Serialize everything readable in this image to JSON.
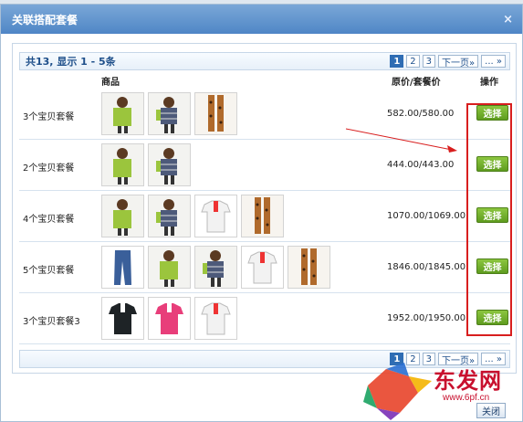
{
  "dialog": {
    "title": "关联搭配套餐",
    "close_glyph": "×"
  },
  "pager": {
    "summary": "共13, 显示 1 - 5条",
    "pages": [
      "1",
      "2",
      "3"
    ],
    "next_label": "下一页»",
    "more_label": "... »"
  },
  "table": {
    "headers": {
      "product": "商品",
      "price": "原价/套餐价",
      "action": "操作"
    },
    "rows": [
      {
        "name": "3个宝贝套餐",
        "price": "582.00/580.00",
        "action": "选择",
        "items": [
          "green-jacket",
          "plaid-top",
          "leopard-tights"
        ]
      },
      {
        "name": "2个宝贝套餐",
        "price": "444.00/443.00",
        "action": "选择",
        "items": [
          "green-jacket",
          "plaid-top"
        ]
      },
      {
        "name": "4个宝贝套餐",
        "price": "1070.00/1069.00",
        "action": "选择",
        "items": [
          "green-jacket",
          "plaid-top",
          "white-polo",
          "leopard-tights"
        ]
      },
      {
        "name": "5个宝贝套餐",
        "price": "1846.00/1845.00",
        "action": "选择",
        "items": [
          "jeans",
          "green-jacket",
          "plaid-top",
          "white-polo",
          "leopard-tights"
        ]
      },
      {
        "name": "3个宝贝套餐3",
        "price": "1952.00/1950.00",
        "action": "选择",
        "items": [
          "black-polo",
          "pink-polo",
          "white-polo"
        ]
      }
    ]
  },
  "footer": {
    "close_label": "关闭"
  },
  "watermark": {
    "text": "东发网",
    "url": "www.6pf.cn"
  },
  "colors": {
    "title_bar": "#4f86c6",
    "button_green": "#6aa82a",
    "highlight_red": "#d81e1e"
  }
}
